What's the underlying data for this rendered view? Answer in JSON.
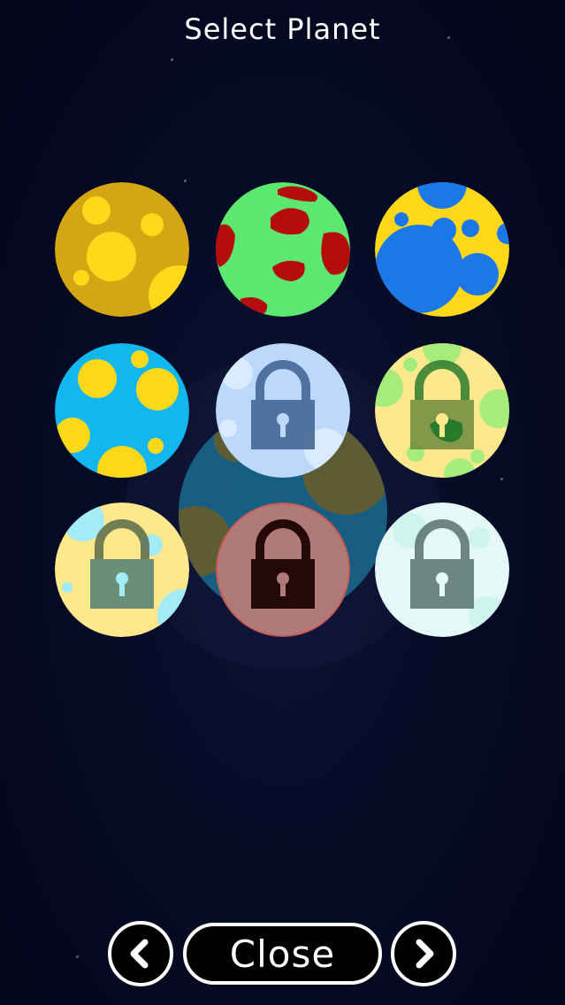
{
  "title": "Select Planet",
  "buttons": {
    "prev": "chevron-left",
    "close": "Close",
    "next": "chevron-right"
  },
  "planets": [
    {
      "id": "planet-1",
      "base": "#d4a613",
      "spot": "#ffd81a",
      "locked": false
    },
    {
      "id": "planet-2",
      "base": "#5ce870",
      "spot": "#b50d0d",
      "locked": false
    },
    {
      "id": "planet-3",
      "base": "#ffd81a",
      "spot": "#1c78e8",
      "locked": false
    },
    {
      "id": "planet-4",
      "base": "#12b7ef",
      "spot": "#ffd81a",
      "locked": false
    },
    {
      "id": "planet-5",
      "base": "#bcd9fb",
      "spot": "#d9ebff",
      "locked": true
    },
    {
      "id": "planet-6",
      "base": "#fde88d",
      "spot": "#a6ec7b",
      "locked": true
    },
    {
      "id": "planet-7",
      "base": "#fde88d",
      "spot": "#a3ebf7",
      "locked": true
    },
    {
      "id": "planet-8",
      "base": "#b07a78",
      "spot": "#b07a78",
      "locked": true
    },
    {
      "id": "planet-9",
      "base": "#e4f8f7",
      "spot": "#cdf5ee",
      "locked": true
    }
  ]
}
